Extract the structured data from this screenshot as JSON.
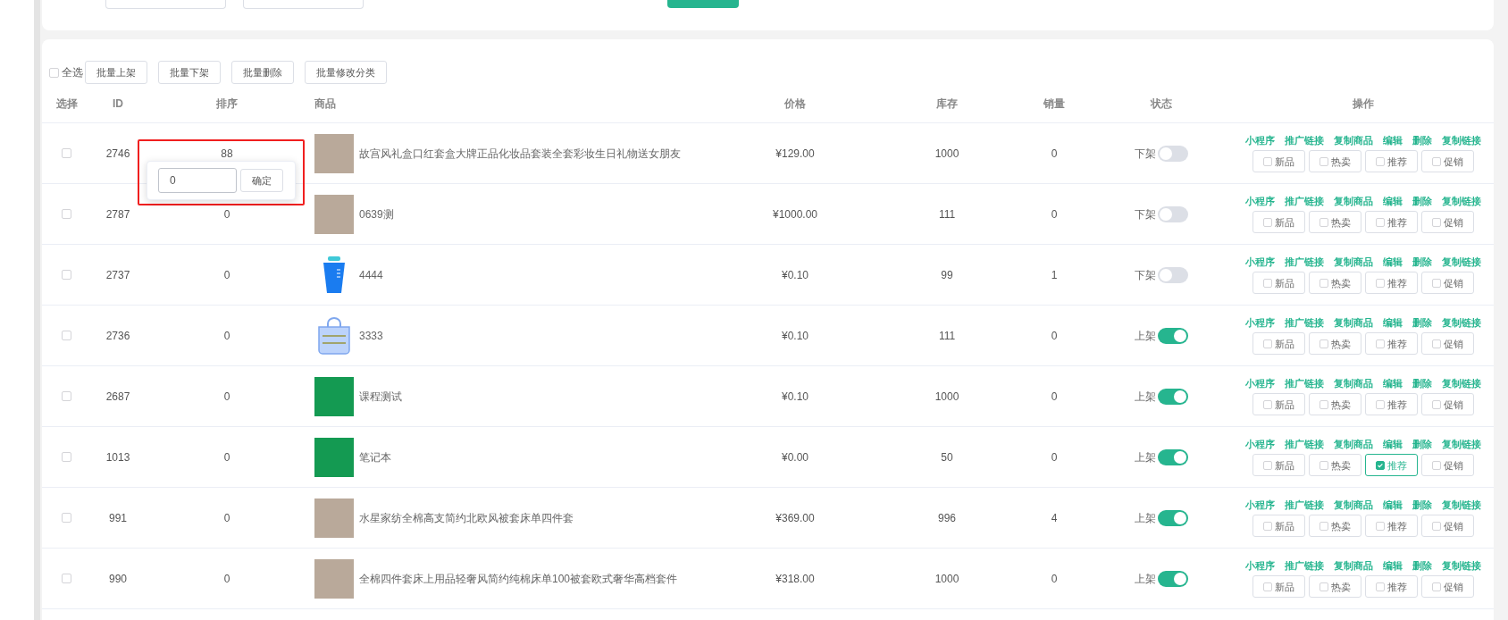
{
  "toolbar": {
    "select_all": {
      "label": "全选",
      "checked": false
    },
    "buttons": [
      "批量上架",
      "批量下架",
      "批量删除",
      "批量修改分类"
    ]
  },
  "table": {
    "columns": [
      "选择",
      "ID",
      "排序",
      "商品",
      "价格",
      "库存",
      "销量",
      "状态",
      "操作"
    ],
    "rows": [
      {
        "checked": false,
        "id": "2746",
        "sort": "88",
        "thumb": {
          "kind": "photo"
        },
        "name": "故宫风礼盒口红套盒大牌正品化妆品套装全套彩妆生日礼物送女朋友",
        "price": "¥129.00",
        "stock": "1000",
        "sales": "0",
        "status": {
          "label": "下架",
          "on": false
        },
        "links": [
          "小程序",
          "推广链接",
          "复制商品",
          "编辑",
          "删除",
          "复制链接"
        ],
        "tags": [
          {
            "label": "新品",
            "checked": false
          },
          {
            "label": "热卖",
            "checked": false
          },
          {
            "label": "推荐",
            "checked": false
          },
          {
            "label": "促销",
            "checked": false
          }
        ]
      },
      {
        "checked": false,
        "id": "2787",
        "sort": "0",
        "thumb": {
          "kind": "photo"
        },
        "name": "0639测",
        "price": "¥1000.00",
        "stock": "111",
        "sales": "0",
        "status": {
          "label": "下架",
          "on": false
        },
        "links": [
          "小程序",
          "推广链接",
          "复制商品",
          "编辑",
          "删除",
          "复制链接"
        ],
        "tags": [
          {
            "label": "新品",
            "checked": false
          },
          {
            "label": "热卖",
            "checked": false
          },
          {
            "label": "推荐",
            "checked": false
          },
          {
            "label": "促销",
            "checked": false
          }
        ]
      },
      {
        "checked": false,
        "id": "2737",
        "sort": "0",
        "thumb": {
          "kind": "cup"
        },
        "name": "4444",
        "price": "¥0.10",
        "stock": "99",
        "sales": "1",
        "status": {
          "label": "下架",
          "on": false
        },
        "links": [
          "小程序",
          "推广链接",
          "复制商品",
          "编辑",
          "删除",
          "复制链接"
        ],
        "tags": [
          {
            "label": "新品",
            "checked": false
          },
          {
            "label": "热卖",
            "checked": false
          },
          {
            "label": "推荐",
            "checked": false
          },
          {
            "label": "促销",
            "checked": false
          }
        ]
      },
      {
        "checked": false,
        "id": "2736",
        "sort": "0",
        "thumb": {
          "kind": "basket"
        },
        "name": "3333",
        "price": "¥0.10",
        "stock": "111",
        "sales": "0",
        "status": {
          "label": "上架",
          "on": true
        },
        "links": [
          "小程序",
          "推广链接",
          "复制商品",
          "编辑",
          "删除",
          "复制链接"
        ],
        "tags": [
          {
            "label": "新品",
            "checked": false
          },
          {
            "label": "热卖",
            "checked": false
          },
          {
            "label": "推荐",
            "checked": false
          },
          {
            "label": "促销",
            "checked": false
          }
        ]
      },
      {
        "checked": false,
        "id": "2687",
        "sort": "0",
        "thumb": {
          "kind": "tile"
        },
        "name": "课程测试",
        "price": "¥0.10",
        "stock": "1000",
        "sales": "0",
        "status": {
          "label": "上架",
          "on": true
        },
        "links": [
          "小程序",
          "推广链接",
          "复制商品",
          "编辑",
          "删除",
          "复制链接"
        ],
        "tags": [
          {
            "label": "新品",
            "checked": false
          },
          {
            "label": "热卖",
            "checked": false
          },
          {
            "label": "推荐",
            "checked": false
          },
          {
            "label": "促销",
            "checked": false
          }
        ]
      },
      {
        "checked": false,
        "id": "1013",
        "sort": "0",
        "thumb": {
          "kind": "tile"
        },
        "name": "笔记本",
        "price": "¥0.00",
        "stock": "50",
        "sales": "0",
        "status": {
          "label": "上架",
          "on": true
        },
        "links": [
          "小程序",
          "推广链接",
          "复制商品",
          "编辑",
          "删除",
          "复制链接"
        ],
        "tags": [
          {
            "label": "新品",
            "checked": false
          },
          {
            "label": "热卖",
            "checked": false
          },
          {
            "label": "推荐",
            "checked": true
          },
          {
            "label": "促销",
            "checked": false
          }
        ]
      },
      {
        "checked": false,
        "id": "991",
        "sort": "0",
        "thumb": {
          "kind": "photo"
        },
        "name": "水星家纺全棉高支简约北欧风被套床单四件套",
        "price": "¥369.00",
        "stock": "996",
        "sales": "4",
        "status": {
          "label": "上架",
          "on": true
        },
        "links": [
          "小程序",
          "推广链接",
          "复制商品",
          "编辑",
          "删除",
          "复制链接"
        ],
        "tags": [
          {
            "label": "新品",
            "checked": false
          },
          {
            "label": "热卖",
            "checked": false
          },
          {
            "label": "推荐",
            "checked": false
          },
          {
            "label": "促销",
            "checked": false
          }
        ]
      },
      {
        "checked": false,
        "id": "990",
        "sort": "0",
        "thumb": {
          "kind": "photo"
        },
        "name": "全棉四件套床上用品轻奢风简约纯棉床单100被套欧式奢华高档套件",
        "price": "¥318.00",
        "stock": "1000",
        "sales": "0",
        "status": {
          "label": "上架",
          "on": true
        },
        "links": [
          "小程序",
          "推广链接",
          "复制商品",
          "编辑",
          "删除",
          "复制链接"
        ],
        "tags": [
          {
            "label": "新品",
            "checked": false
          },
          {
            "label": "热卖",
            "checked": false
          },
          {
            "label": "推荐",
            "checked": false
          },
          {
            "label": "促销",
            "checked": false
          }
        ]
      }
    ]
  },
  "popover": {
    "value": "0",
    "button": "确定"
  }
}
